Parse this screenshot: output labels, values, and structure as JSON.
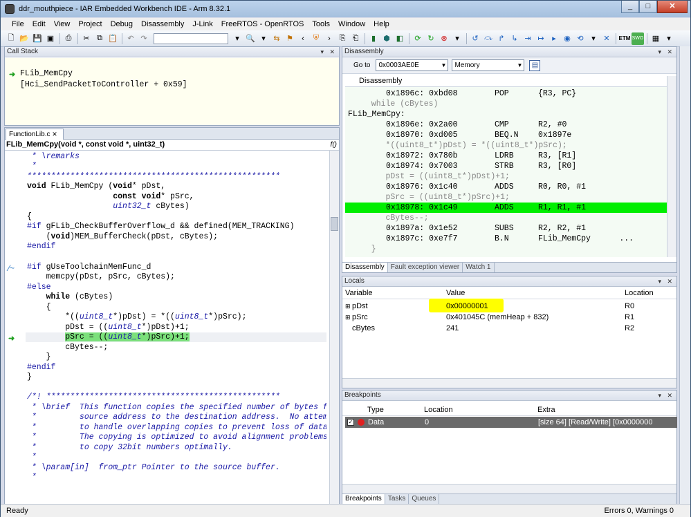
{
  "window": {
    "title": "ddr_mouthpiece - IAR Embedded Workbench IDE - Arm 8.32.1"
  },
  "menu": [
    "File",
    "Edit",
    "View",
    "Project",
    "Debug",
    "Disassembly",
    "J-Link",
    "FreeRTOS - OpenRTOS",
    "Tools",
    "Window",
    "Help"
  ],
  "callstack": {
    "title": "Call Stack",
    "lines": [
      "FLib_MemCpy",
      "[Hci_SendPacketToController + 0x59]"
    ]
  },
  "editor": {
    "tab": "FunctionLib.c",
    "function": "FLib_MemCpy(void *, const void *, uint32_t)",
    "func_glyph": "f()"
  },
  "disassembly": {
    "title": "Disassembly",
    "goto_label": "Go to",
    "goto_value": "0x0003AE0E",
    "memory_label": "Memory",
    "header": "Disassembly",
    "rows": [
      {
        "kind": "asm",
        "addr": "0x1896c: 0xbd08",
        "mn": "POP",
        "op": "{R3, PC}"
      },
      {
        "kind": "src",
        "text": "  while (cBytes)"
      },
      {
        "kind": "label",
        "text": "FLib_MemCpy:"
      },
      {
        "kind": "asm",
        "addr": "0x1896e: 0x2a00",
        "mn": "CMP",
        "op": "R2, #0"
      },
      {
        "kind": "asm",
        "addr": "0x18970: 0xd005",
        "mn": "BEQ.N",
        "op": "0x1897e"
      },
      {
        "kind": "src",
        "text": "     *((uint8_t*)pDst) = *((uint8_t*)pSrc);"
      },
      {
        "kind": "asm",
        "addr": "0x18972: 0x780b",
        "mn": "LDRB",
        "op": "R3, [R1]"
      },
      {
        "kind": "asm",
        "addr": "0x18974: 0x7003",
        "mn": "STRB",
        "op": "R3, [R0]"
      },
      {
        "kind": "src",
        "text": "     pDst = ((uint8_t*)pDst)+1;"
      },
      {
        "kind": "asm",
        "addr": "0x18976: 0x1c40",
        "mn": "ADDS",
        "op": "R0, R0, #1"
      },
      {
        "kind": "src",
        "text": "     pSrc = ((uint8_t*)pSrc)+1;"
      },
      {
        "kind": "hl",
        "addr": "0x18978: 0x1c49",
        "mn": "ADDS",
        "op": "R1, R1, #1"
      },
      {
        "kind": "src",
        "text": "     cBytes--;"
      },
      {
        "kind": "asm",
        "addr": "0x1897a: 0x1e52",
        "mn": "SUBS",
        "op": "R2, R2, #1"
      },
      {
        "kind": "asm",
        "addr": "0x1897c: 0xe7f7",
        "mn": "B.N",
        "op": "FLib_MemCpy      ..."
      },
      {
        "kind": "src",
        "text": "  }"
      }
    ],
    "tabs": [
      "Disassembly",
      "Fault exception viewer",
      "Watch 1"
    ]
  },
  "locals": {
    "title": "Locals",
    "columns": [
      "Variable",
      "Value",
      "Location"
    ],
    "rows": [
      {
        "var": "pDst",
        "value": "0x00000001",
        "loc": "R0",
        "expand": "⊞"
      },
      {
        "var": "pSrc",
        "value": "0x401045C (memHeap + 832)",
        "loc": "R1",
        "expand": "⊞"
      },
      {
        "var": "cBytes",
        "value": "241",
        "loc": "R2",
        "expand": ""
      }
    ],
    "highlight_color": "#ffff00"
  },
  "breakpoints": {
    "title": "Breakpoints",
    "columns": [
      "Type",
      "Location",
      "Extra"
    ],
    "row": {
      "type": "Data",
      "location": "0",
      "extra": "[size 64] [Read/Write] [0x0000000"
    },
    "tabs": [
      "Breakpoints",
      "Tasks",
      "Queues"
    ]
  },
  "status": {
    "left": "Ready",
    "right": "Errors 0, Warnings 0"
  },
  "colors": {
    "current_line": "#00ee00",
    "arrow": "#20a020",
    "selection": "#7be07b"
  }
}
